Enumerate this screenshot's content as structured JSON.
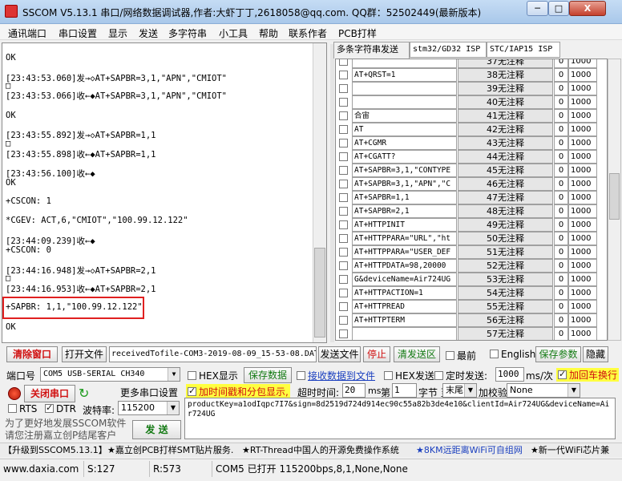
{
  "window": {
    "title": "SSCOM V5.13.1 串口/网络数据调试器,作者:大虾丁丁,2618058@qq.com. QQ群：52502449(最新版本)",
    "min_label": "─",
    "max_label": "□",
    "close_label": "X"
  },
  "menu": [
    "通讯端口",
    "串口设置",
    "显示",
    "发送",
    "多字符串",
    "小工具",
    "帮助",
    "联系作者",
    "PCB打样"
  ],
  "log": [
    "OK",
    "[23:43:53.060]发→◇AT+SAPBR=3,1,\"APN\",\"CMIOT\"",
    "□",
    "[23:43:53.066]收←◆AT+SAPBR=3,1,\"APN\",\"CMIOT\"",
    "OK",
    "[23:43:55.892]发→◇AT+SAPBR=1,1",
    "□",
    "[23:43:55.898]收←◆AT+SAPBR=1,1",
    "[23:43:56.100]收←◆",
    "OK",
    "+CSCON: 1",
    "*CGEV: ACT,6,\"CMIOT\",\"100.99.12.122\"",
    "[23:44:09.239]收←◆",
    "+CSCON: 0",
    "[23:44:16.948]发→◇AT+SAPBR=2,1",
    "□",
    "[23:44:16.953]收←◆AT+SAPBR=2,1",
    "+SAPBR: 1,1,\"100.99.12.122\"",
    "OK"
  ],
  "tabs": [
    "多条字符串发送",
    "stm32/GD32 ISP",
    "STC/IAP15 ISP"
  ],
  "commands": [
    {
      "cmd": "",
      "btn": "37无注释",
      "idx": "0",
      "delay": "1000"
    },
    {
      "cmd": "AT+QRST=1",
      "btn": "38无注释",
      "idx": "0",
      "delay": "1000"
    },
    {
      "cmd": "",
      "btn": "39无注释",
      "idx": "0",
      "delay": "1000"
    },
    {
      "cmd": "",
      "btn": "40无注释",
      "idx": "0",
      "delay": "1000"
    },
    {
      "cmd": "合宙",
      "btn": "41无注释",
      "idx": "0",
      "delay": "1000"
    },
    {
      "cmd": "AT",
      "btn": "42无注释",
      "idx": "0",
      "delay": "1000"
    },
    {
      "cmd": "AT+CGMR",
      "btn": "43无注释",
      "idx": "0",
      "delay": "1000"
    },
    {
      "cmd": "AT+CGATT?",
      "btn": "44无注释",
      "idx": "0",
      "delay": "1000"
    },
    {
      "cmd": "AT+SAPBR=3,1,\"CONTYPE",
      "btn": "45无注释",
      "idx": "0",
      "delay": "1000"
    },
    {
      "cmd": "AT+SAPBR=3,1,\"APN\",\"C",
      "btn": "46无注释",
      "idx": "0",
      "delay": "1000"
    },
    {
      "cmd": "AT+SAPBR=1,1",
      "btn": "47无注释",
      "idx": "0",
      "delay": "1000"
    },
    {
      "cmd": "AT+SAPBR=2,1",
      "btn": "48无注释",
      "idx": "0",
      "delay": "1000"
    },
    {
      "cmd": "AT+HTTPINIT",
      "btn": "49无注释",
      "idx": "0",
      "delay": "1000"
    },
    {
      "cmd": "AT+HTTPPARA=\"URL\",\"ht",
      "btn": "50无注释",
      "idx": "0",
      "delay": "1000"
    },
    {
      "cmd": "AT+HTTPPARA=\"USER_DEF",
      "btn": "51无注释",
      "idx": "0",
      "delay": "1000"
    },
    {
      "cmd": "AT+HTTPDATA=98,20000",
      "btn": "52无注释",
      "idx": "0",
      "delay": "1000"
    },
    {
      "cmd": "G&deviceName=Air724UG",
      "btn": "53无注释",
      "idx": "0",
      "delay": "1000"
    },
    {
      "cmd": "AT+HTTPACTION=1",
      "btn": "54无注释",
      "idx": "0",
      "delay": "1000"
    },
    {
      "cmd": "AT+HTTPREAD",
      "btn": "55无注释",
      "idx": "0",
      "delay": "1000"
    },
    {
      "cmd": "AT+HTTPTERM",
      "btn": "56无注释",
      "idx": "0",
      "delay": "1000"
    },
    {
      "cmd": "",
      "btn": "57无注释",
      "idx": "0",
      "delay": "1000"
    }
  ],
  "toolbar": {
    "clear_window": "清除窗口",
    "open_file": "打开文件",
    "file_path": "receivedTofile-COM3-2019-08-09_15-53-08.DAT",
    "send_file": "发送文件",
    "stop": "停止",
    "clear_send": "清发送区",
    "topmost": "最前",
    "english": "English",
    "save_params": "保存参数",
    "hide": "隐藏"
  },
  "settings": {
    "port_label": "端口号",
    "port_value": "COM5 USB-SERIAL CH340",
    "hex_display": "HEX显示",
    "save_data": "保存数据",
    "recv_to_file": "接收数据到文件",
    "hex_send": "HEX发送",
    "timed_send": "定时发送:",
    "timed_value": "1000",
    "timed_unit": "ms/次",
    "add_crlf": "加回车换行",
    "close_port": "关闭串口",
    "more_settings": "更多串口设置",
    "timestamp": "加时间戳和分包显示,",
    "timeout_label": "超时时间:",
    "timeout_value": "20",
    "timeout_unit": "ms",
    "byte_no_prefix": "第",
    "byte_no": "1",
    "byte_label": "字节 至",
    "byte_to": "末尾",
    "checksum_label": "加校验",
    "checksum_value": "None",
    "rts": "RTS",
    "dtr": "DTR",
    "baud_label": "波特率:",
    "baud_value": "115200",
    "promo": "为了更好地发展SSCOM软件\n请您注册嘉立创P结尾客户",
    "send": "发  送",
    "send_text": "productKey=a1odIqpc7I7&sign=8d2519d724d914ec90c55a82b3de4e10&clientId=Air724UG&deviceName=Air724UG"
  },
  "ads": [
    "【升级到SSCOM5.13.1】",
    "★嘉立创PCB打样SMT贴片服务.",
    "★RT-Thread中国人的开源免费操作系统",
    "★8KM远距离WiFi可自组网",
    "★新一代WiFi芯片兼"
  ],
  "status": {
    "website": "www.daxia.com",
    "sent": "S:127",
    "received": "R:573",
    "port_status": "COM5 已打开  115200bps,8,1,None,None"
  },
  "colors": {
    "accent_red": "#d01010",
    "accent_green": "#137a13",
    "highlight_box": "#e02020",
    "titlebar": "#a9c8ea"
  }
}
